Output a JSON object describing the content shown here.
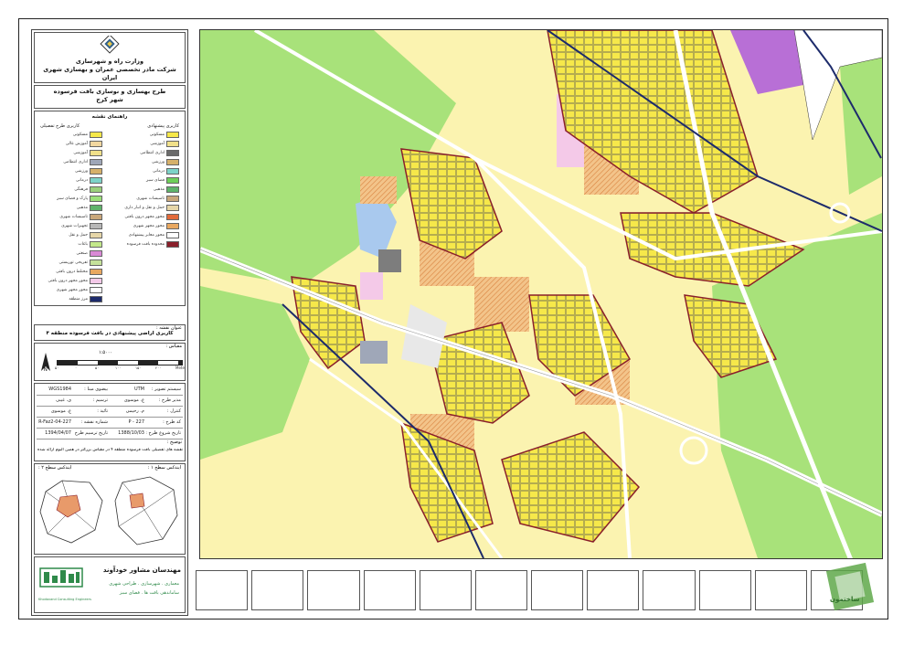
{
  "header": {
    "ministry": "وزارت راه و شهرسازی",
    "company": "شرکت مادر تخصصی عمران و بهسازی شهری ایران",
    "project_title": "طرح بهسازی و نوسازی بافت فرسوده",
    "city": "شهر کرج"
  },
  "legend": {
    "heading": "راهنمای نقشه",
    "left_heading": "کاربری طرح تفصیلی",
    "right_heading": "کاربری پیشنهادی",
    "left_items": [
      {
        "label": "مسکونی",
        "color": "#f6e84a"
      },
      {
        "label": "آموزش عالی",
        "color": "#f2d7a0"
      },
      {
        "label": "آموزشی",
        "color": "#f0e08a"
      },
      {
        "label": "اداری انتظامی",
        "color": "#9fa7b8"
      },
      {
        "label": "ورزشی",
        "color": "#d6b06a"
      },
      {
        "label": "درمانی",
        "color": "#7dd3c8"
      },
      {
        "label": "فرهنگی",
        "color": "#9ad07b"
      },
      {
        "label": "پارک و فضای سبز",
        "color": "#9be07a"
      },
      {
        "label": "مذهبی",
        "color": "#5fb36b"
      },
      {
        "label": "تاسیسات شهری",
        "color": "#c9a77b"
      },
      {
        "label": "تجهیزات شهری",
        "color": "#b7b7b7"
      },
      {
        "label": "حمل و نقل",
        "color": "#e6d6a8"
      },
      {
        "label": "باغات",
        "color": "#c3e88a"
      },
      {
        "label": "صنعتی",
        "color": "#d989d6"
      },
      {
        "label": "تفریحی توریستی",
        "color": "#c5e29a"
      },
      {
        "label": "مختلط درون بافتی",
        "color": "#e8a860"
      },
      {
        "label": "محور مجهز درون بافتی",
        "color": "#f4c9e8"
      },
      {
        "label": "محور مجهز شهری",
        "color": "#ffffff"
      },
      {
        "label": "مرز منطقه",
        "color": "#1d2b6b"
      }
    ],
    "right_items": [
      {
        "label": "مسکونی",
        "color": "#f6e84a"
      },
      {
        "label": "آموزشی",
        "color": "#f0e08a"
      },
      {
        "label": "اداری انتظامی",
        "color": "#6b6b6b"
      },
      {
        "label": "ورزشی",
        "color": "#d6b06a"
      },
      {
        "label": "درمانی",
        "color": "#7dd3c8"
      },
      {
        "label": "فضای سبز",
        "color": "#6fcf5a"
      },
      {
        "label": "مذهبی",
        "color": "#5fb36b"
      },
      {
        "label": "تاسیسات شهری",
        "color": "#c9a77b"
      },
      {
        "label": "حمل و نقل و انبار داری",
        "color": "#e6d6a8"
      },
      {
        "label": "محور مجهز درون بافتی",
        "color": "#e26a3a"
      },
      {
        "label": "محور مجهز شهری",
        "color": "#e8a860"
      },
      {
        "label": "محور معابر پیشنهادی",
        "color": "#ffffff"
      },
      {
        "label": "محدوده بافت فرسوده",
        "color": "#8a1f2b"
      }
    ]
  },
  "map_title": {
    "label": "عنوان نقشه :",
    "value": "کاربری اراضی پیشنهادی در بافت فرسوده منطقه ۴"
  },
  "scale": {
    "label": "مقیاس :",
    "ratio": "۱:۵۰۰۰",
    "ticks": [
      "۵۰",
      "۰",
      "۵۰",
      "۱۰۰",
      "۱۵۰",
      "۲۰۰",
      "Meters"
    ]
  },
  "info": {
    "projection_label": "سیستم تصویر :",
    "projection": "UTM",
    "datum_label": "بیضوی مبنا :",
    "datum": "WGS1984",
    "director_label": "مدیر طرح :",
    "director": "ع. موسوی",
    "drafter_label": "ترسیم :",
    "drafter": "ی. غیبی",
    "supervisor_label": "کنترل :",
    "supervisor": "م. رحیمی",
    "approver_label": "تائید :",
    "approver": "ع. موسوی",
    "code_label": "کد طرح :",
    "code": "P - 227",
    "sheet_label": "شماره نقشه :",
    "sheet": "227-R-Faz2-04",
    "start_label": "تاریخ شروع طرح :",
    "start": "1388/10/03",
    "draw_date_label": "تاریخ ترسیم طرح :",
    "draw_date": "1394/04/07",
    "note_label": "توضیح :",
    "note": "نقشه های تفصیلی بافت فرسوده منطقه ۴ در مقیاس بزرگتر در همین آلبوم ارائه شده است"
  },
  "index_maps": {
    "left_title": "ایندکس سطح ۲ :",
    "right_title": "ایندکس سطح ۱ :"
  },
  "consultant": {
    "name": "مهندسان مشاور خودآوند",
    "services_1": "معماری . شهرسازی . طراحی شهری",
    "services_2": "ساماندهی بافت ها . فضای سبز",
    "latin": "Khodavand Consulting Engineers"
  },
  "compass": {
    "north": "N"
  },
  "watermark": "ساختمون"
}
